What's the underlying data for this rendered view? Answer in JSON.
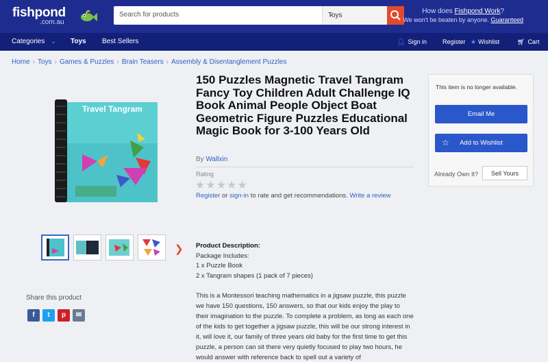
{
  "header": {
    "logo_name": "fishpond",
    "logo_tld": ".com.au",
    "search_placeholder": "Search for products",
    "search_category": "Toys",
    "work_line1": "How does ",
    "work_link1": "Fishpond Work",
    "work_q": "?",
    "work_line2": "We won't be beaten by anyone. ",
    "work_link2": "Guaranteed"
  },
  "nav": {
    "categories": "Categories",
    "toys": "Toys",
    "best_sellers": "Best Sellers",
    "sign_in": "Sign in",
    "register": "Register",
    "wishlist": "Wishlist",
    "cart": "Cart"
  },
  "breadcrumb": [
    "Home",
    "Toys",
    "Games & Puzzles",
    "Brain Teasers",
    "Assembly & Disentanglement Puzzles"
  ],
  "product": {
    "title": "150 Puzzles Magnetic Travel Tangram Fancy Toy Children Adult Challenge IQ Book Animal People Object Boat Geometric Figure Puzzles Educational Magic Book for 3-100 Years Old",
    "by_label": "By ",
    "brand": "Wallxin",
    "rating_label": "Rating",
    "stars": "★★★★★",
    "rate_register": "Register",
    "rate_or": " or ",
    "rate_signin": "sign-in",
    "rate_mid": " to rate and get recommendations. ",
    "rate_write": "Write a review",
    "image_title": "Travel Tangram"
  },
  "panel": {
    "notice": "This item is no longer available.",
    "email_me": "Email Me",
    "add_wishlist": "Add to Wishlist",
    "already_own": "Already Own It?",
    "sell_yours": "Sell Yours"
  },
  "description": {
    "heading": "Product Description:",
    "lines": [
      "Package Includes:",
      "1 x Puzzle Book",
      "2 x Tangram shapes (1 pack of 7 pieces)"
    ],
    "paragraph": "This is a Montessori teaching mathematics in a jigsaw puzzle, this puzzle we have 150 questions, 150 answers, so that our kids enjoy the play to their imagination to the puzzle. To complete a problem, as long as each one of the kids to get together a jigsaw puzzle, this will be our strong interest in it, will love it, our family of three years old baby for the first time to get this puzzle, a person can sit there very quietly focused to play two hours, he would answer with reference back to spell out a variety of"
  },
  "share": {
    "label": "Share this product",
    "icons": [
      "f",
      "t",
      "p",
      "✉"
    ]
  },
  "colors": {
    "header_bg": "#1f2c8f",
    "nav_bg": "#13207a",
    "accent": "#e24a2c",
    "button": "#2a57c9",
    "link": "#2f5fc4"
  }
}
